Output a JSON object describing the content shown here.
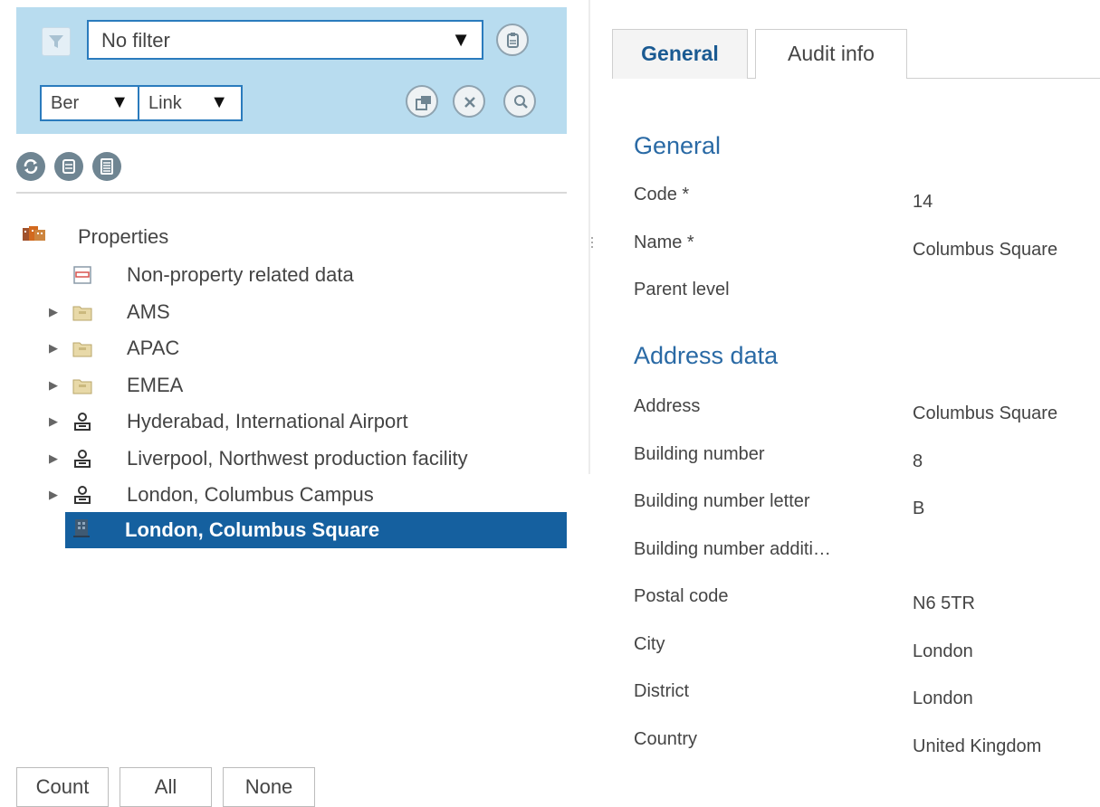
{
  "filter": {
    "selected": "No filter",
    "dropdown1_value": "Ber",
    "dropdown2_value": "Link"
  },
  "tree": {
    "root_label": "Properties",
    "items": [
      {
        "label": "Non-property related data",
        "icon": "data-sheet-icon",
        "expandable": false
      },
      {
        "label": "AMS",
        "icon": "folder-icon",
        "expandable": true
      },
      {
        "label": "APAC",
        "icon": "folder-icon",
        "expandable": true
      },
      {
        "label": "EMEA",
        "icon": "folder-icon",
        "expandable": true
      },
      {
        "label": "Hyderabad, International Airport",
        "icon": "property-icon",
        "expandable": true
      },
      {
        "label": "Liverpool, Northwest production facility",
        "icon": "property-icon",
        "expandable": true
      },
      {
        "label": "London, Columbus Campus",
        "icon": "property-icon",
        "expandable": true
      }
    ],
    "selected_label": "London, Columbus Square"
  },
  "bottom_buttons": {
    "count": "Count",
    "all": "All",
    "none": "None"
  },
  "tabs": {
    "general": "General",
    "audit": "Audit info"
  },
  "general_section": {
    "title": "General",
    "fields": [
      {
        "label": "Code *",
        "value": "14"
      },
      {
        "label": "Name *",
        "value": "Columbus Square"
      },
      {
        "label": "Parent level",
        "value": ""
      }
    ]
  },
  "address_section": {
    "title": "Address data",
    "fields": [
      {
        "label": "Address",
        "value": "Columbus Square"
      },
      {
        "label": "Building number",
        "value": "8"
      },
      {
        "label": "Building number letter",
        "value": "B"
      },
      {
        "label": "Building number additi…",
        "value": ""
      },
      {
        "label": "Postal code",
        "value": "N6 5TR"
      },
      {
        "label": "City",
        "value": "London"
      },
      {
        "label": "District",
        "value": "London"
      },
      {
        "label": "Country",
        "value": "United Kingdom"
      }
    ]
  },
  "colors": {
    "filter_panel_bg": "#b8dcef",
    "selection_bg": "#15609f",
    "section_title": "#2a6aa5",
    "active_tab_text": "#1a5a92"
  }
}
